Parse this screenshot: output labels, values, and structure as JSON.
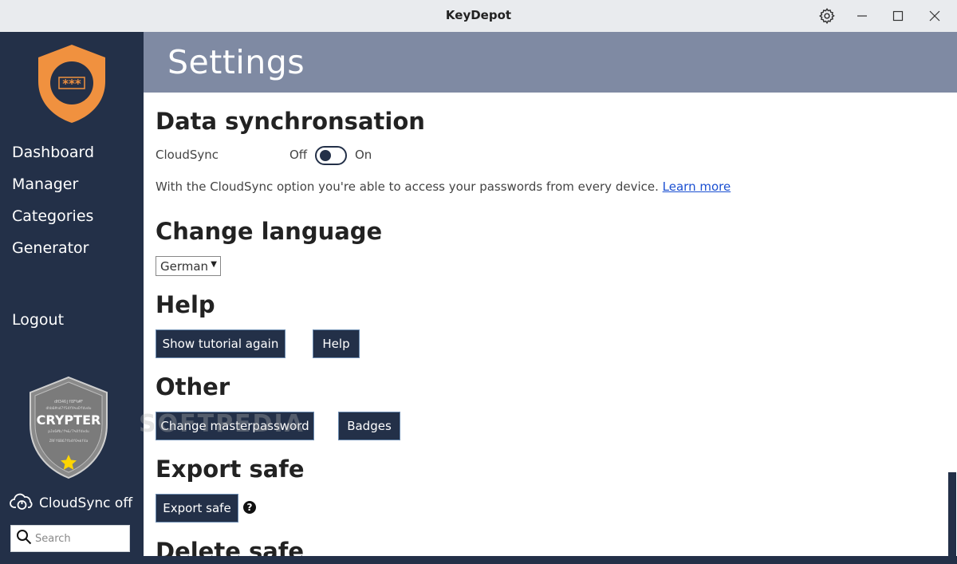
{
  "window": {
    "title": "KeyDepot",
    "settings_icon": "gear-icon",
    "minimize_icon": "minimize-icon",
    "maximize_icon": "maximize-icon",
    "close_icon": "close-icon"
  },
  "sidebar": {
    "logo": {
      "icon": "shield-password-icon",
      "text": "***"
    },
    "items": [
      {
        "label": "Dashboard"
      },
      {
        "label": "Manager"
      },
      {
        "label": "Categories"
      },
      {
        "label": "Generator"
      }
    ],
    "logout_label": "Logout",
    "badge": {
      "icon": "crypter-badge-icon",
      "title": "CRYPTER",
      "lines": [
        "dH346jf8F%#F",
        "dhb6#nd7fS4fX%vDfdvdu",
        "pJo6#b/f%&/7%Xfdvdu",
        "ZRFf6B67fb4f6%kf4a"
      ]
    },
    "cloudsync_status": "CloudSync off",
    "search": {
      "placeholder": "Search"
    }
  },
  "header": {
    "title": "Settings"
  },
  "main": {
    "sync": {
      "title": "Data synchronsation",
      "cloudsync_label": "CloudSync",
      "off_label": "Off",
      "on_label": "On",
      "toggle_state": "off",
      "description": "With the CloudSync option you're able to access your passwords from every device.",
      "learn_more": "Learn more"
    },
    "language": {
      "title": "Change language",
      "selected": "German"
    },
    "help": {
      "title": "Help",
      "tutorial_button": "Show tutorial again",
      "help_button": "Help"
    },
    "other": {
      "title": "Other",
      "masterpassword_button": "Change masterpassword",
      "badges_button": "Badges"
    },
    "export": {
      "title": "Export safe",
      "export_button": "Export safe",
      "help_icon": "?"
    },
    "delete": {
      "title": "Delete safe"
    }
  },
  "watermark": "SOFTPEDIA",
  "colors": {
    "sidebar_bg": "#233048",
    "header_bg": "#7f8aa3",
    "shield_orange": "#f0913f",
    "button_bg": "#233048"
  }
}
